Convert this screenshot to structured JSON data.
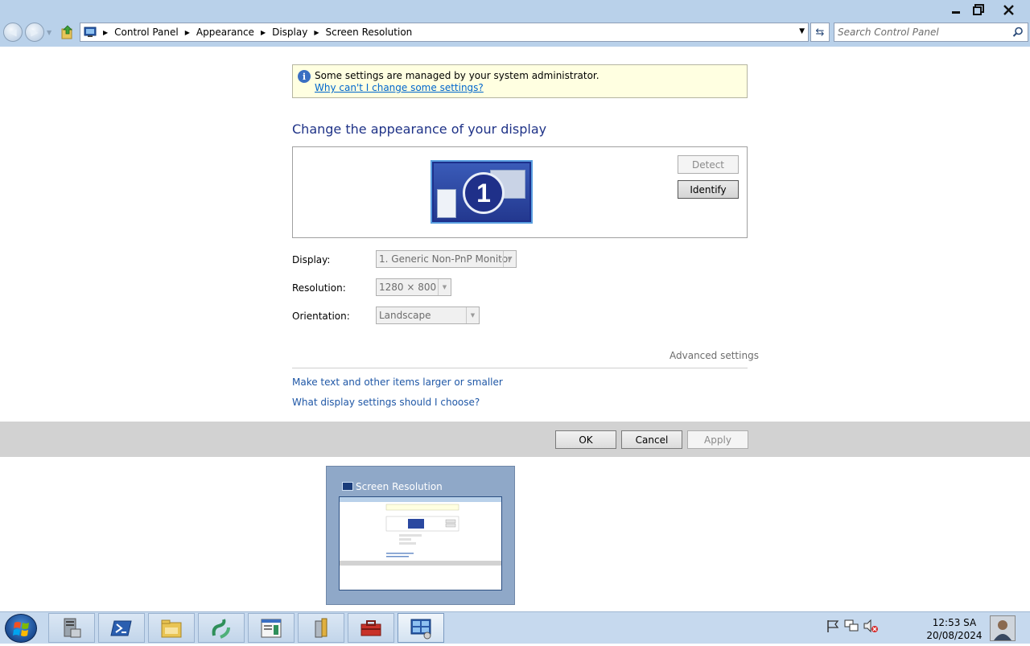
{
  "window": {
    "controls": [
      "minimize-icon",
      "restore-icon",
      "close-icon"
    ]
  },
  "address_bar": {
    "breadcrumbs": [
      "Control Panel",
      "Appearance",
      "Display",
      "Screen Resolution"
    ],
    "search_placeholder": "Search Control Panel"
  },
  "info_bar": {
    "message": "Some settings are managed by your system administrator.",
    "link": "Why can't I change some settings?"
  },
  "main": {
    "heading": "Change the appearance of your display",
    "monitor_number": "1",
    "detect_label": "Detect",
    "identify_label": "Identify",
    "display_label": "Display:",
    "display_value": "1. Generic Non-PnP Monitor",
    "resolution_label": "Resolution:",
    "resolution_value": "1280 × 800",
    "orientation_label": "Orientation:",
    "orientation_value": "Landscape",
    "advanced_settings": "Advanced settings",
    "link_text_size": "Make text and other items larger or smaller",
    "link_what_settings": "What display settings should I choose?"
  },
  "buttons": {
    "ok": "OK",
    "cancel": "Cancel",
    "apply": "Apply"
  },
  "thumbnail": {
    "title": "Screen Resolution"
  },
  "taskbar": {
    "items": [
      "server-manager-icon",
      "powershell-icon",
      "file-explorer-icon",
      "network-tool-icon",
      "event-viewer-icon",
      "tools-icon",
      "toolbox-icon",
      "control-panel-icon"
    ],
    "tray_icons": [
      "flag-icon",
      "network-icon",
      "volume-muted-icon"
    ],
    "time": "12:53 SA",
    "date": "20/08/2024"
  }
}
